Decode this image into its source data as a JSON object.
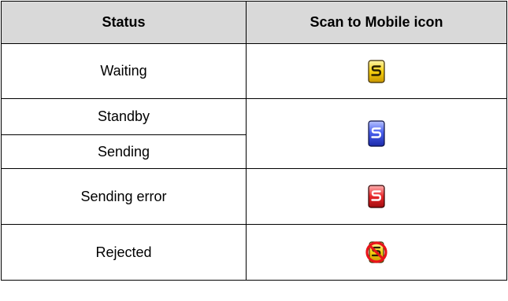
{
  "table": {
    "headers": {
      "status": "Status",
      "icon": "Scan to Mobile icon"
    },
    "rows": {
      "waiting": {
        "status": "Waiting",
        "icon": "scan-to-mobile-yellow-icon"
      },
      "standby": {
        "status": "Standby",
        "icon": "scan-to-mobile-blue-icon"
      },
      "sending": {
        "status": "Sending",
        "icon": "scan-to-mobile-blue-icon"
      },
      "sending_error": {
        "status": "Sending error",
        "icon": "scan-to-mobile-red-icon"
      },
      "rejected": {
        "status": "Rejected",
        "icon": "scan-to-mobile-prohibited-icon"
      }
    }
  },
  "colors": {
    "header_bg": "#d9d9d9",
    "border": "#000000",
    "yellow": "#f2c400",
    "blue": "#3c4fe0",
    "red": "#e8272a"
  }
}
